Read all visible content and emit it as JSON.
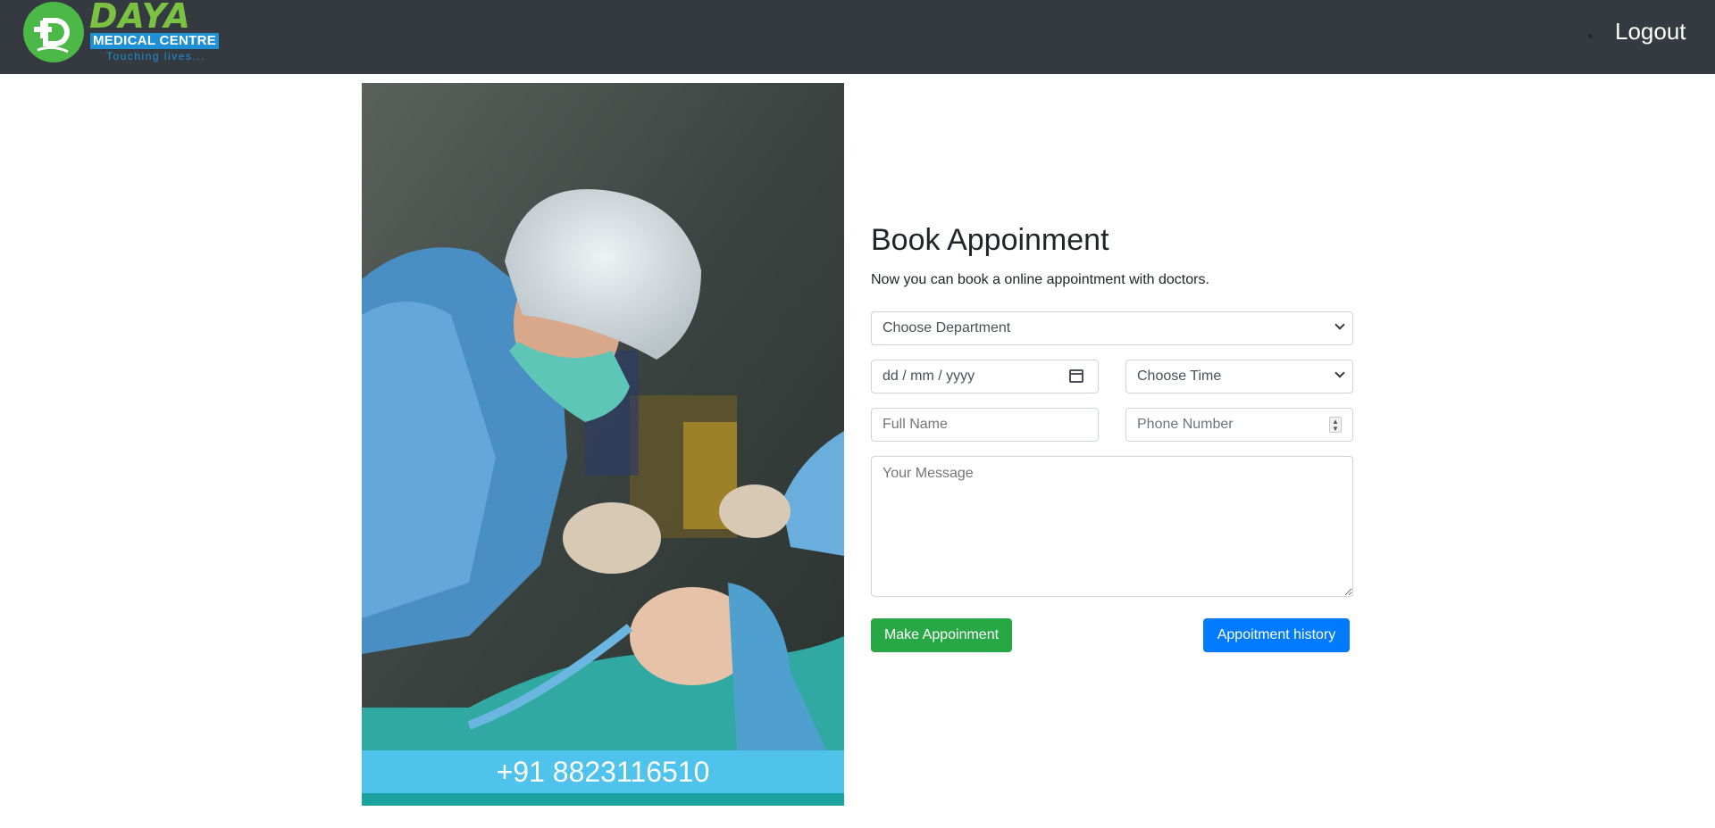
{
  "navbar": {
    "logo": {
      "word": "DAYA",
      "banner": "MEDICAL CENTRE",
      "tagline": "Touching lives..."
    },
    "logout_label": "Logout"
  },
  "photo": {
    "phone": "+91 8823116510"
  },
  "form": {
    "title": "Book Appoinment",
    "subtitle": "Now you can book a online appointment with doctors.",
    "department_selected": "Choose Department",
    "date_placeholder": "dd / mm / yyyy",
    "time_selected": "Choose Time",
    "fullname_placeholder": "Full Name",
    "phone_placeholder": "Phone Number",
    "message_placeholder": "Your Message",
    "submit_label": "Make Appoinment",
    "history_label": "Appoitment history"
  },
  "colors": {
    "navbar": "#343a40",
    "logo_green": "#7cc242",
    "logo_blue": "#1e90d6",
    "phone_bar": "#4fc3ec",
    "submit": "#28a745",
    "history": "#007bff"
  }
}
